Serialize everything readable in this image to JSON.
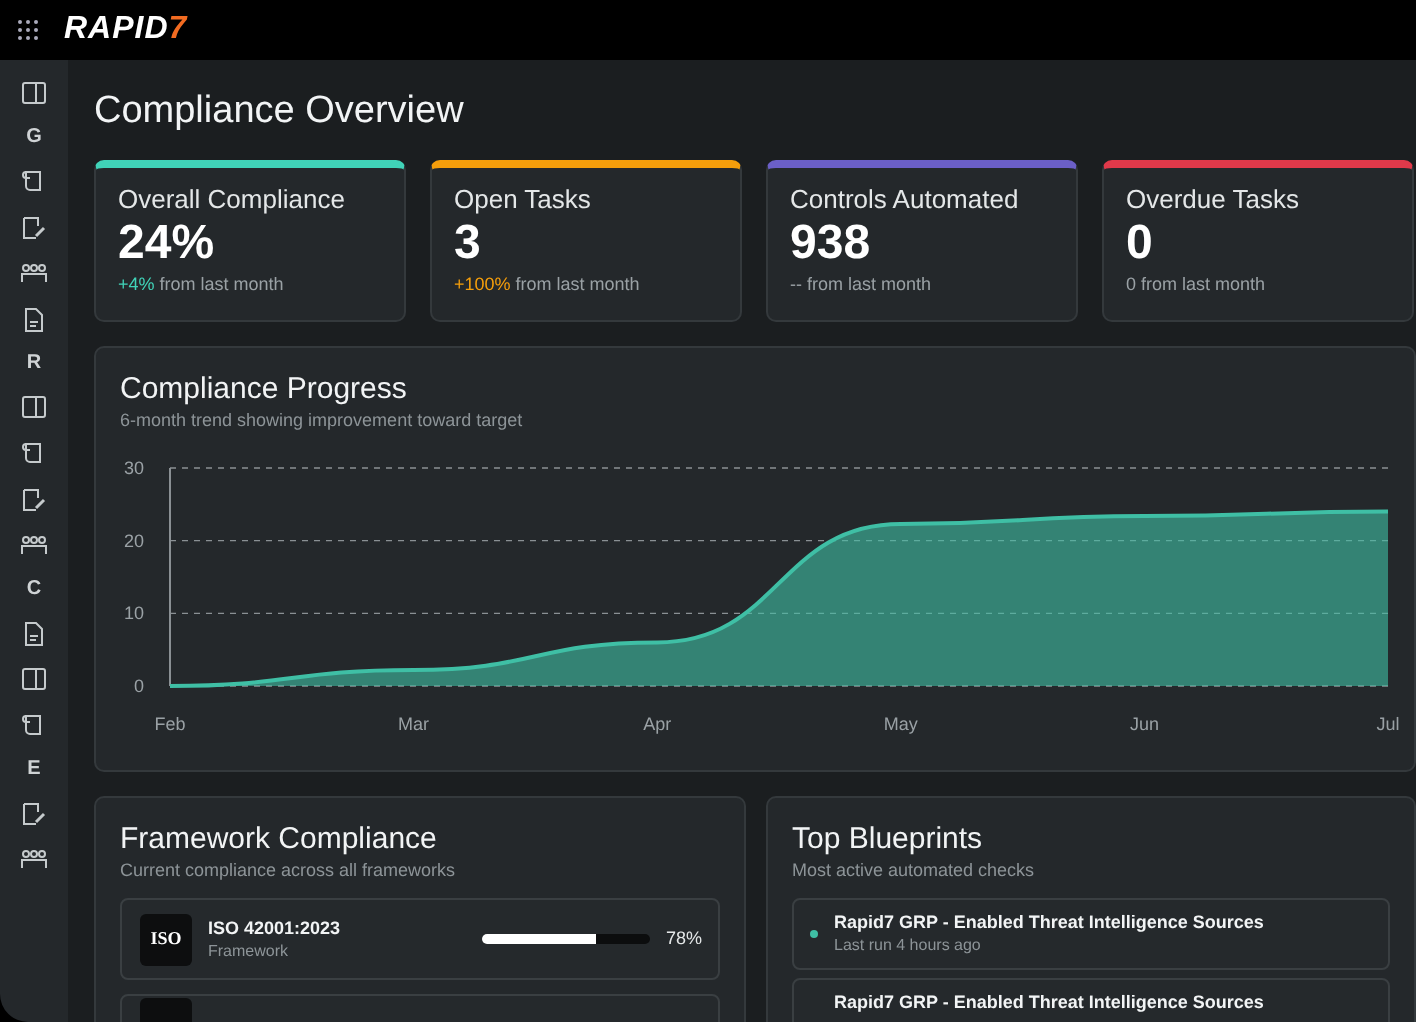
{
  "topbar": {
    "logo": "RAPID7"
  },
  "sidebar": [
    {
      "kind": "icon"
    },
    {
      "kind": "heading",
      "text": "G"
    },
    {
      "kind": "icon"
    },
    {
      "kind": "icon"
    },
    {
      "kind": "icon"
    },
    {
      "kind": "icon"
    },
    {
      "kind": "heading",
      "text": "R"
    },
    {
      "kind": "icon"
    },
    {
      "kind": "icon"
    },
    {
      "kind": "icon"
    },
    {
      "kind": "icon"
    },
    {
      "kind": "heading",
      "text": "C"
    },
    {
      "kind": "icon"
    },
    {
      "kind": "icon"
    },
    {
      "kind": "icon"
    },
    {
      "kind": "heading",
      "text": "E"
    },
    {
      "kind": "icon"
    },
    {
      "kind": "icon"
    }
  ],
  "page_title": "Compliance Overview",
  "stats": [
    {
      "label": "Overall Compliance",
      "value": "24%",
      "change": "+4%",
      "highlighted": true,
      "note": "from last month",
      "color": "#40d3b8"
    },
    {
      "label": "Open Tasks",
      "value": "3",
      "change": "+100%",
      "highlighted": true,
      "note": "from last month",
      "color": "#f59e0b"
    },
    {
      "label": "Controls Automated",
      "value": "938",
      "change": "--",
      "highlighted": false,
      "note": "from last month",
      "color": "#6b5fc7"
    },
    {
      "label": "Overdue Tasks",
      "value": "0",
      "change": "0",
      "highlighted": false,
      "note": "from last month",
      "color": "#e0394a"
    }
  ],
  "progress": {
    "title": "Compliance Progress",
    "subtitle": "6-month trend showing improvement toward target",
    "chart_data": {
      "type": "area",
      "categories": [
        "Feb",
        "Mar",
        "Apr",
        "May",
        "Jun",
        "Jul"
      ],
      "series": [
        {
          "color": "#3fbfa5",
          "values": [
            0,
            2.2,
            6,
            22.3,
            23.4,
            24
          ]
        }
      ],
      "ylim": [
        0,
        30
      ],
      "yticks": [
        {
          "value": 0,
          "label": "0"
        },
        {
          "value": 10,
          "label": "10"
        },
        {
          "value": 20,
          "label": "20"
        },
        {
          "value": 30,
          "label": "30"
        }
      ]
    }
  },
  "frameworks": {
    "title": "Framework Compliance",
    "subtitle": "Current compliance across all frameworks",
    "items": [
      {
        "logo_text": "ISO",
        "name": "ISO 42001:2023",
        "type": "Framework",
        "level": 0.68,
        "reading": "78%"
      }
    ]
  },
  "blueprints": {
    "title": "Top Blueprints",
    "subtitle": "Most active automated checks",
    "items": [
      {
        "name": "Rapid7 GRP - Enabled Threat Intelligence Sources",
        "meta": "Last run 4 hours ago",
        "color": "#3fbfa5"
      },
      {
        "name": "Rapid7 GRP - Enabled Threat Intelligence Sources"
      }
    ]
  }
}
